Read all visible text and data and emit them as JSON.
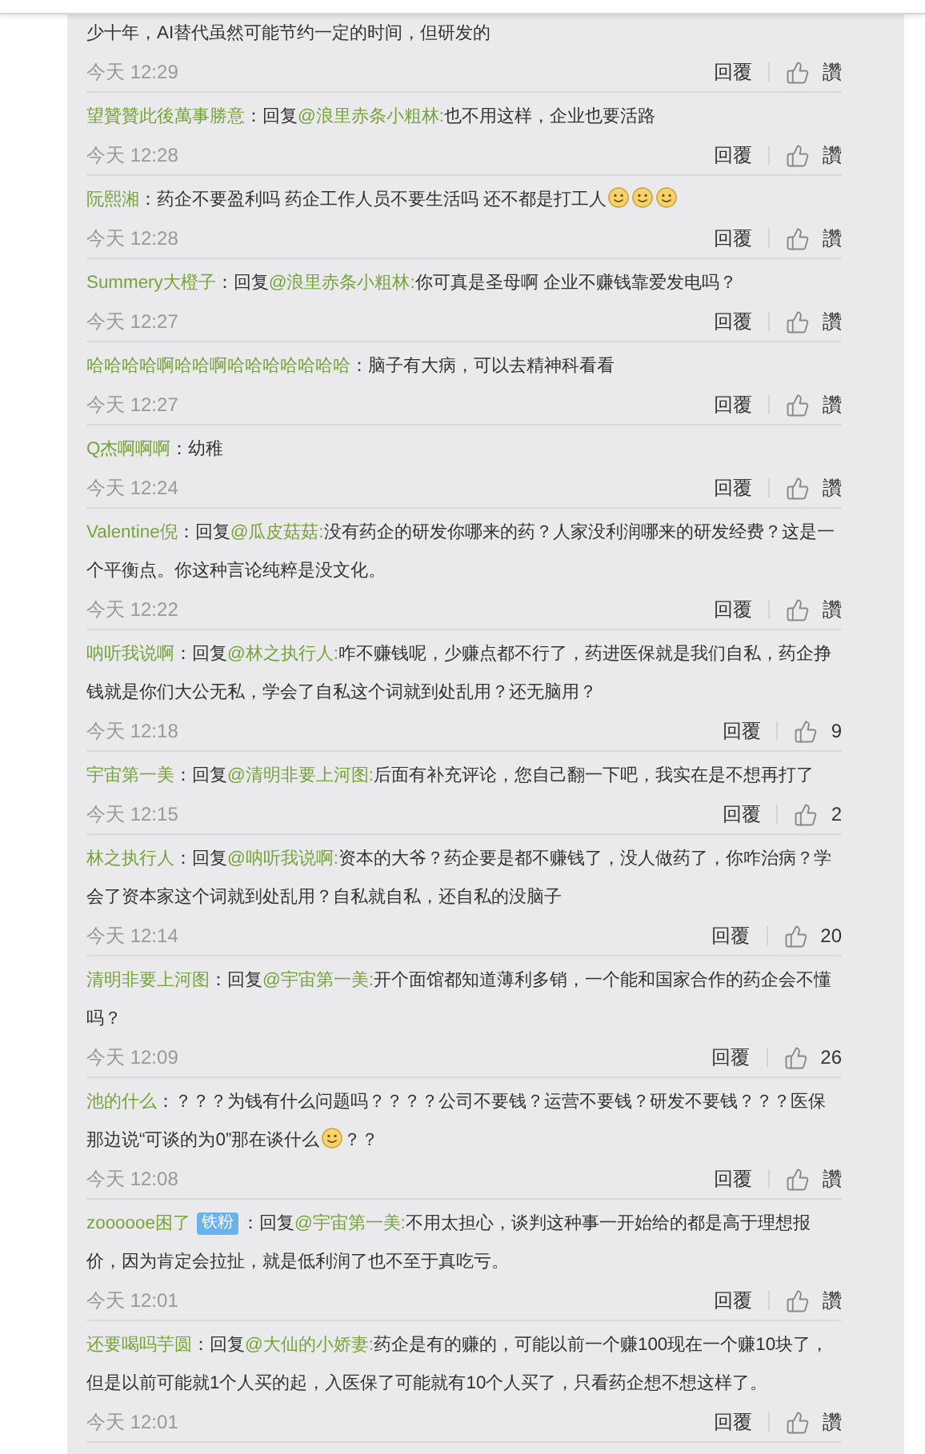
{
  "comments": [
    {
      "parts": [
        {
          "kind": "text",
          "text": "少十年，AI替代虽然可能节约一定的时间，但研发的"
        }
      ],
      "time": "今天 12:29",
      "reply_label": "回覆",
      "likes": "讚"
    },
    {
      "user": "望贊贊此後萬事勝意",
      "separator": "：",
      "reply_prefix": "回复",
      "mention": "@浪里赤条小粗林:",
      "parts": [
        {
          "kind": "text",
          "text": "也不用这样，企业也要活路"
        }
      ],
      "time": "今天 12:28",
      "reply_label": "回覆",
      "likes": "讚"
    },
    {
      "user": "阮熙湘",
      "separator": "：",
      "parts": [
        {
          "kind": "text",
          "text": "药企不要盈利吗 药企工作人员不要生活吗 还不都是打工人"
        },
        {
          "kind": "emoji"
        },
        {
          "kind": "emoji"
        },
        {
          "kind": "emoji"
        }
      ],
      "time": "今天 12:28",
      "reply_label": "回覆",
      "likes": "讚"
    },
    {
      "user": "Summery大橙子",
      "separator": "：",
      "reply_prefix": "回复",
      "mention": "@浪里赤条小粗林:",
      "parts": [
        {
          "kind": "text",
          "text": "你可真是圣母啊 企业不赚钱靠爱发电吗？"
        }
      ],
      "time": "今天 12:27",
      "reply_label": "回覆",
      "likes": "讚"
    },
    {
      "user": "哈哈哈哈啊哈哈啊哈哈哈哈哈哈哈",
      "separator": "：",
      "parts": [
        {
          "kind": "text",
          "text": "脑子有大病，可以去精神科看看"
        }
      ],
      "time": "今天 12:27",
      "reply_label": "回覆",
      "likes": "讚"
    },
    {
      "user": "Q杰啊啊啊",
      "separator": "：",
      "parts": [
        {
          "kind": "text",
          "text": "幼稚"
        }
      ],
      "time": "今天 12:24",
      "reply_label": "回覆",
      "likes": "讚"
    },
    {
      "user": "Valentine倪",
      "separator": "：",
      "reply_prefix": "回复",
      "mention": "@瓜皮菇菇:",
      "parts": [
        {
          "kind": "text",
          "text": "没有药企的研发你哪来的药？人家没利润哪来的研发经费？这是一个平衡点。你这种言论纯粹是没文化。"
        }
      ],
      "time": "今天 12:22",
      "reply_label": "回覆",
      "likes": "讚"
    },
    {
      "user": "呐听我说啊",
      "separator": "：",
      "reply_prefix": "回复",
      "mention": "@林之执行人:",
      "parts": [
        {
          "kind": "text",
          "text": "咋不赚钱呢，少赚点都不行了，药进医保就是我们自私，药企挣钱就是你们大公无私，学会了自私这个词就到处乱用？还无脑用？"
        }
      ],
      "time": "今天 12:18",
      "reply_label": "回覆",
      "likes": "9"
    },
    {
      "user": "宇宙第一美",
      "separator": "：",
      "reply_prefix": "回复",
      "mention": "@清明非要上河图:",
      "parts": [
        {
          "kind": "text",
          "text": "后面有补充评论，您自己翻一下吧，我实在是不想再打了"
        }
      ],
      "time": "今天 12:15",
      "reply_label": "回覆",
      "likes": "2"
    },
    {
      "user": "林之执行人",
      "separator": "：",
      "reply_prefix": "回复",
      "mention": "@呐听我说啊:",
      "parts": [
        {
          "kind": "text",
          "text": "资本的大爷？药企要是都不赚钱了，没人做药了，你咋治病？学会了资本家这个词就到处乱用？自私就自私，还自私的没脑子"
        }
      ],
      "time": "今天 12:14",
      "reply_label": "回覆",
      "likes": "20"
    },
    {
      "user": "清明非要上河图",
      "separator": "：",
      "reply_prefix": "回复",
      "mention": "@宇宙第一美:",
      "parts": [
        {
          "kind": "text",
          "text": "开个面馆都知道薄利多销，一个能和国家合作的药企会不懂吗？"
        }
      ],
      "time": "今天 12:09",
      "reply_label": "回覆",
      "likes": "26"
    },
    {
      "user": "池的什么",
      "separator": "：",
      "parts": [
        {
          "kind": "text",
          "text": "？？？为钱有什么问题吗？？？？公司不要钱？运营不要钱？研发不要钱？？？医保那边说“可谈的为0”那在谈什么"
        },
        {
          "kind": "emoji"
        },
        {
          "kind": "text",
          "text": "？？"
        }
      ],
      "time": "今天 12:08",
      "reply_label": "回覆",
      "likes": "讚"
    },
    {
      "user": "zoooooe困了",
      "badge": "铁粉",
      "separator": "：",
      "reply_prefix": "回复",
      "mention": "@宇宙第一美:",
      "parts": [
        {
          "kind": "text",
          "text": "不用太担心，谈判这种事一开始给的都是高于理想报价，因为肯定会拉扯，就是低利润了也不至于真吃亏。"
        }
      ],
      "time": "今天 12:01",
      "reply_label": "回覆",
      "likes": "讚"
    },
    {
      "user": "还要喝吗芋圆",
      "separator": "：",
      "reply_prefix": "回复",
      "mention": "@大仙的小娇妻:",
      "parts": [
        {
          "kind": "text",
          "text": "药企是有的赚的，可能以前一个赚100现在一个赚10块了，但是以前可能就1个人买的起，入医保了可能就有10个人买了，只看药企想不想这样了。"
        }
      ],
      "time": "今天 12:01",
      "reply_label": "回覆",
      "likes": "讚"
    }
  ]
}
